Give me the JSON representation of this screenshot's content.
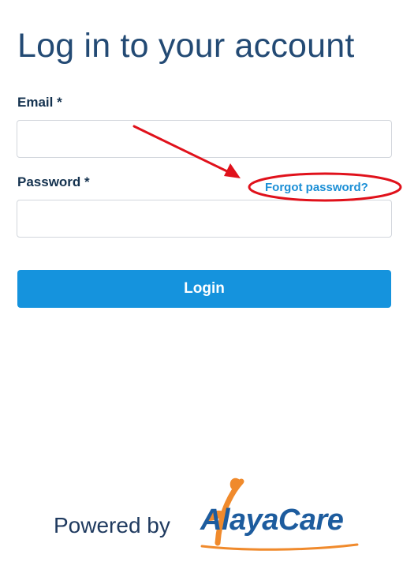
{
  "page": {
    "title": "Log in to your account"
  },
  "form": {
    "email_label": "Email *",
    "email_value": "",
    "password_label": "Password *",
    "password_value": "",
    "forgot_link": "Forgot password?",
    "login_button": "Login"
  },
  "footer": {
    "powered_by": "Powered by",
    "brand": "AlayaCare"
  },
  "colors": {
    "title": "#234a74",
    "link": "#1b8fd6",
    "button": "#1593dd",
    "annotation": "#e0111b",
    "brand_orange": "#f08a2c",
    "brand_blue": "#1d5c9e"
  },
  "icons": [
    "annotation-arrow-icon",
    "annotation-ellipse-icon",
    "alayacare-leaf-icon"
  ]
}
